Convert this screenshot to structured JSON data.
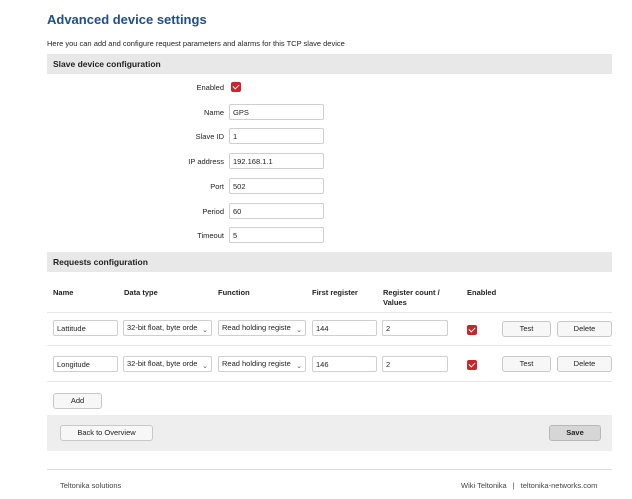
{
  "page": {
    "title": "Advanced device settings",
    "subtitle": "Here you can add and configure request parameters and alarms for this TCP slave device"
  },
  "slave_section": {
    "header": "Slave device configuration",
    "fields": {
      "enabled": {
        "label": "Enabled",
        "checked": true
      },
      "name": {
        "label": "Name",
        "value": "GPS"
      },
      "slave_id": {
        "label": "Slave ID",
        "value": "1"
      },
      "ip_address": {
        "label": "IP address",
        "value": "192.168.1.1"
      },
      "port": {
        "label": "Port",
        "value": "502"
      },
      "period": {
        "label": "Period",
        "value": "60"
      },
      "timeout": {
        "label": "Timeout",
        "value": "5"
      }
    }
  },
  "requests_section": {
    "header": "Requests configuration",
    "columns": {
      "name": "Name",
      "data_type": "Data type",
      "function": "Function",
      "first_register": "First register",
      "register_count": "Register count /",
      "register_count_2": "Values",
      "enabled": "Enabled"
    },
    "rows": [
      {
        "name": "Lattitude",
        "data_type": "32-bit float, byte orde",
        "function": "Read holding registe",
        "first_register": "144",
        "register_count": "2",
        "enabled": true,
        "test_label": "Test",
        "delete_label": "Delete"
      },
      {
        "name": "Longitude",
        "data_type": "32-bit float, byte orde",
        "function": "Read holding registe",
        "first_register": "146",
        "register_count": "2",
        "enabled": true,
        "test_label": "Test",
        "delete_label": "Delete"
      }
    ],
    "add_label": "Add"
  },
  "actions": {
    "back_label": "Back to Overview",
    "save_label": "Save"
  },
  "footer": {
    "left": "Teltonika solutions",
    "wiki": "Wiki Teltonika",
    "separator": "|",
    "site": "teltonika-networks.com"
  },
  "colors": {
    "title": "#1f4e8c",
    "checkbox": "#c8242b",
    "section_bg": "#e8e8e8"
  }
}
